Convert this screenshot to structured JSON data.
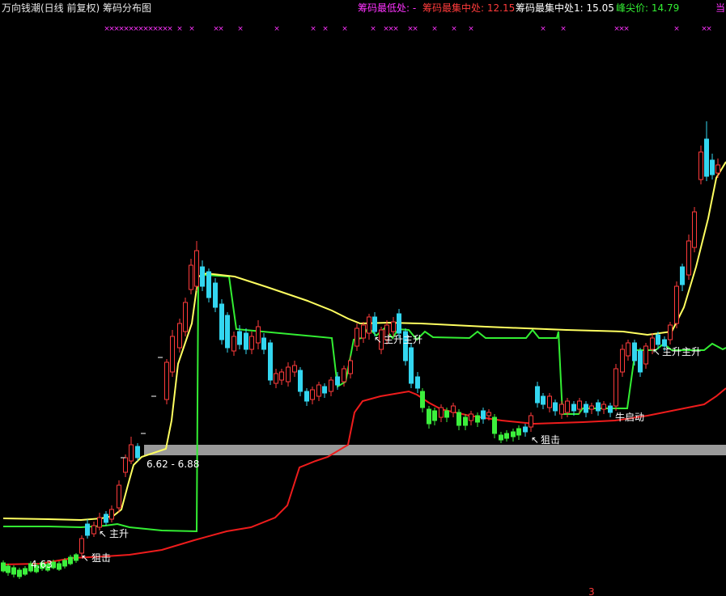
{
  "header": {
    "title": "万向钱潮(日线 前复权) 筹码分布图",
    "lowest_label": "筹码最低处: -",
    "dense_label": "筹码最集中处: 12.15",
    "dense1_label": "筹码最集中处1: 15.05",
    "peak_label": "峰尖价: 14.79",
    "current_label": "当"
  },
  "colors": {
    "background": "#000000",
    "up_candle": "#ff3b3b",
    "down_candle": "#33d6f0",
    "green_candle": "#3cf03c",
    "yellow_line": "#ffff60",
    "green_line": "#33ee33",
    "red_line": "#ee1c1c",
    "magenta": "#ff33ff",
    "band": "#9a9a9a"
  },
  "annotations": {
    "price_a": "4.63",
    "range": "6.62 - 6.88",
    "main_up": "主升",
    "main_up_double": "主升主升",
    "ambush": "狙击",
    "bull_start": "牛启动",
    "arrow": "↖",
    "bottom_mark": "3"
  }
}
